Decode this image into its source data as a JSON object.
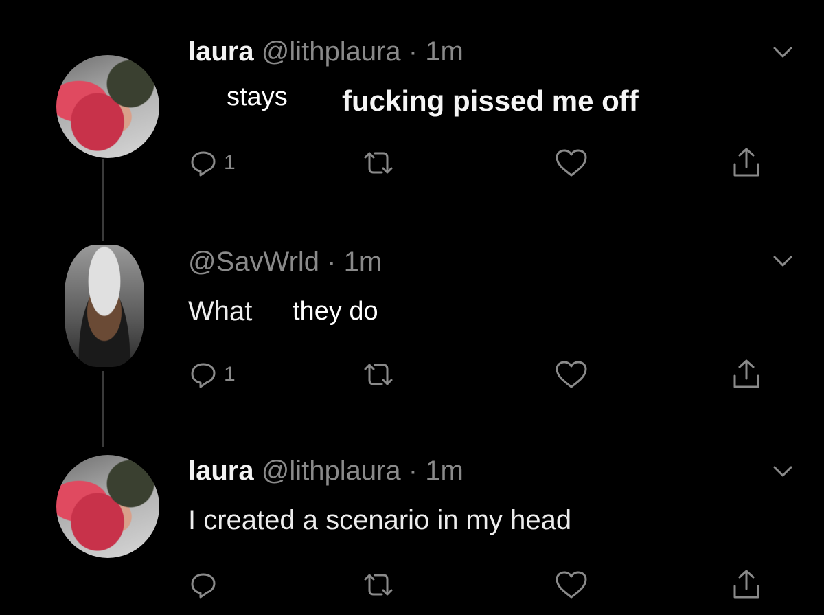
{
  "tweets": [
    {
      "name": "laura",
      "handle": "@lithplaura",
      "dot": "·",
      "time": "1m",
      "text_overlay_1": "stays",
      "text_overlay_2": "fucking pissed me off",
      "reply_count": "1",
      "icons": [
        "reply-icon",
        "retweet-icon",
        "like-icon",
        "share-icon",
        "chevron-down-icon"
      ]
    },
    {
      "name": "",
      "handle": "@SavWrld",
      "dot": "·",
      "time": "1m",
      "text_prefix": "What",
      "text_overlay": "they do",
      "reply_count": "1",
      "icons": [
        "reply-icon",
        "retweet-icon",
        "like-icon",
        "share-icon",
        "chevron-down-icon"
      ]
    },
    {
      "name": "laura",
      "handle": "@lithplaura",
      "dot": "·",
      "time": "1m",
      "text": "I created a scenario in my head",
      "reply_count": "",
      "icons": [
        "reply-icon",
        "retweet-icon",
        "like-icon",
        "share-icon",
        "chevron-down-icon"
      ]
    }
  ],
  "colors": {
    "background": "#000000",
    "text": "#e6e6e6",
    "muted": "#8a8a8a",
    "thread_line": "#3a3a3a"
  }
}
